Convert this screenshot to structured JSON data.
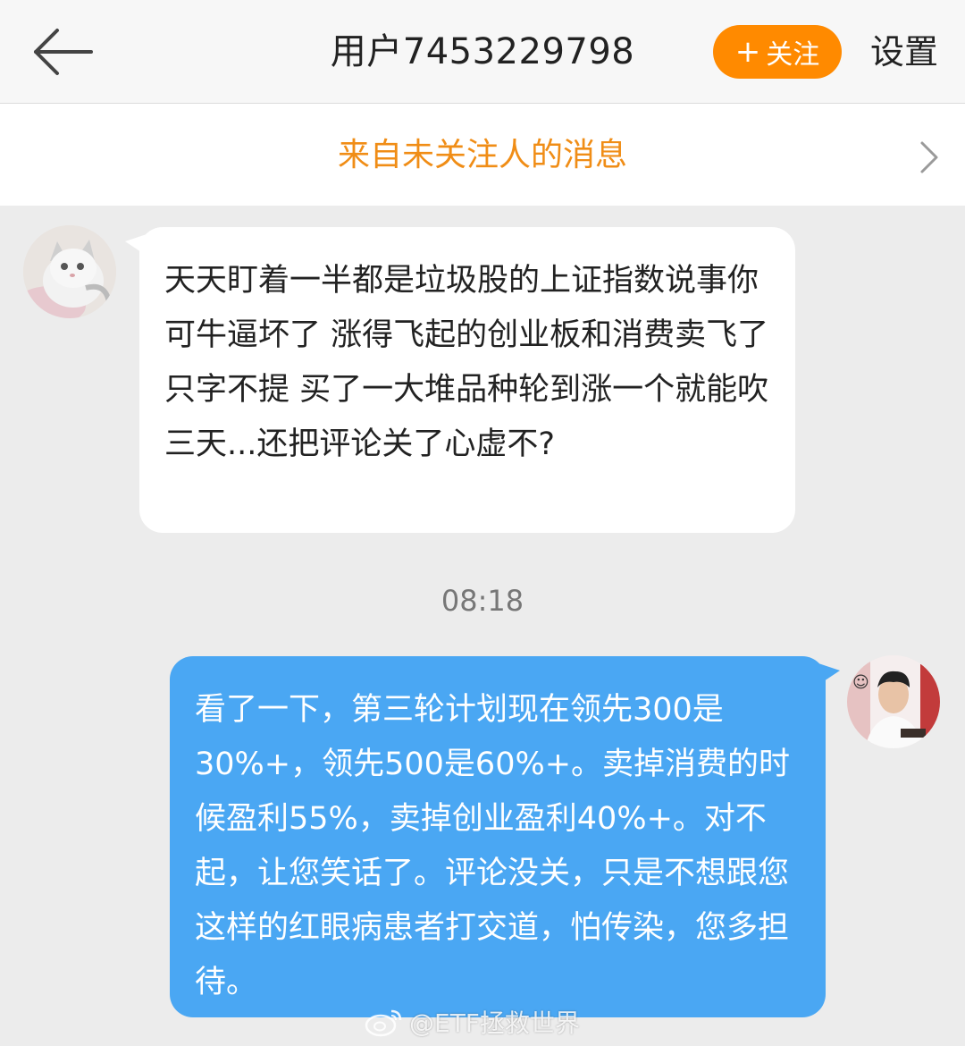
{
  "header": {
    "title": "用户7453229798",
    "follow_label": "关注",
    "follow_plus": "+",
    "settings_label": "设置"
  },
  "notice": {
    "text": "来自未关注人的消息"
  },
  "messages": [
    {
      "side": "left",
      "text": "天天盯着一半都是垃圾股的上证指数说事你可牛逼坏了 涨得飞起的创业板和消费卖飞了只字不提  买了一大堆品种轮到涨一个就能吹三天...还把评论关了心虚不?"
    },
    {
      "side": "right",
      "text": "看了一下，第三轮计划现在领先300是30%+，领先500是60%+。卖掉消费的时候盈利55%，卖掉创业盈利40%+。对不起，让您笑话了。评论没关，只是不想跟您这样的红眼病患者打交道，怕传染，您多担待。"
    }
  ],
  "timestamp": "08:18",
  "watermark": "@ETF拯救世界",
  "colors": {
    "accent_orange": "#ff8a00",
    "notice_orange": "#f08d16",
    "outgoing_bubble": "#4aa7f3",
    "background": "#ececec"
  },
  "icons": {
    "back": "arrow-left-icon",
    "chevron": "chevron-right-icon",
    "weibo": "weibo-logo-icon"
  }
}
